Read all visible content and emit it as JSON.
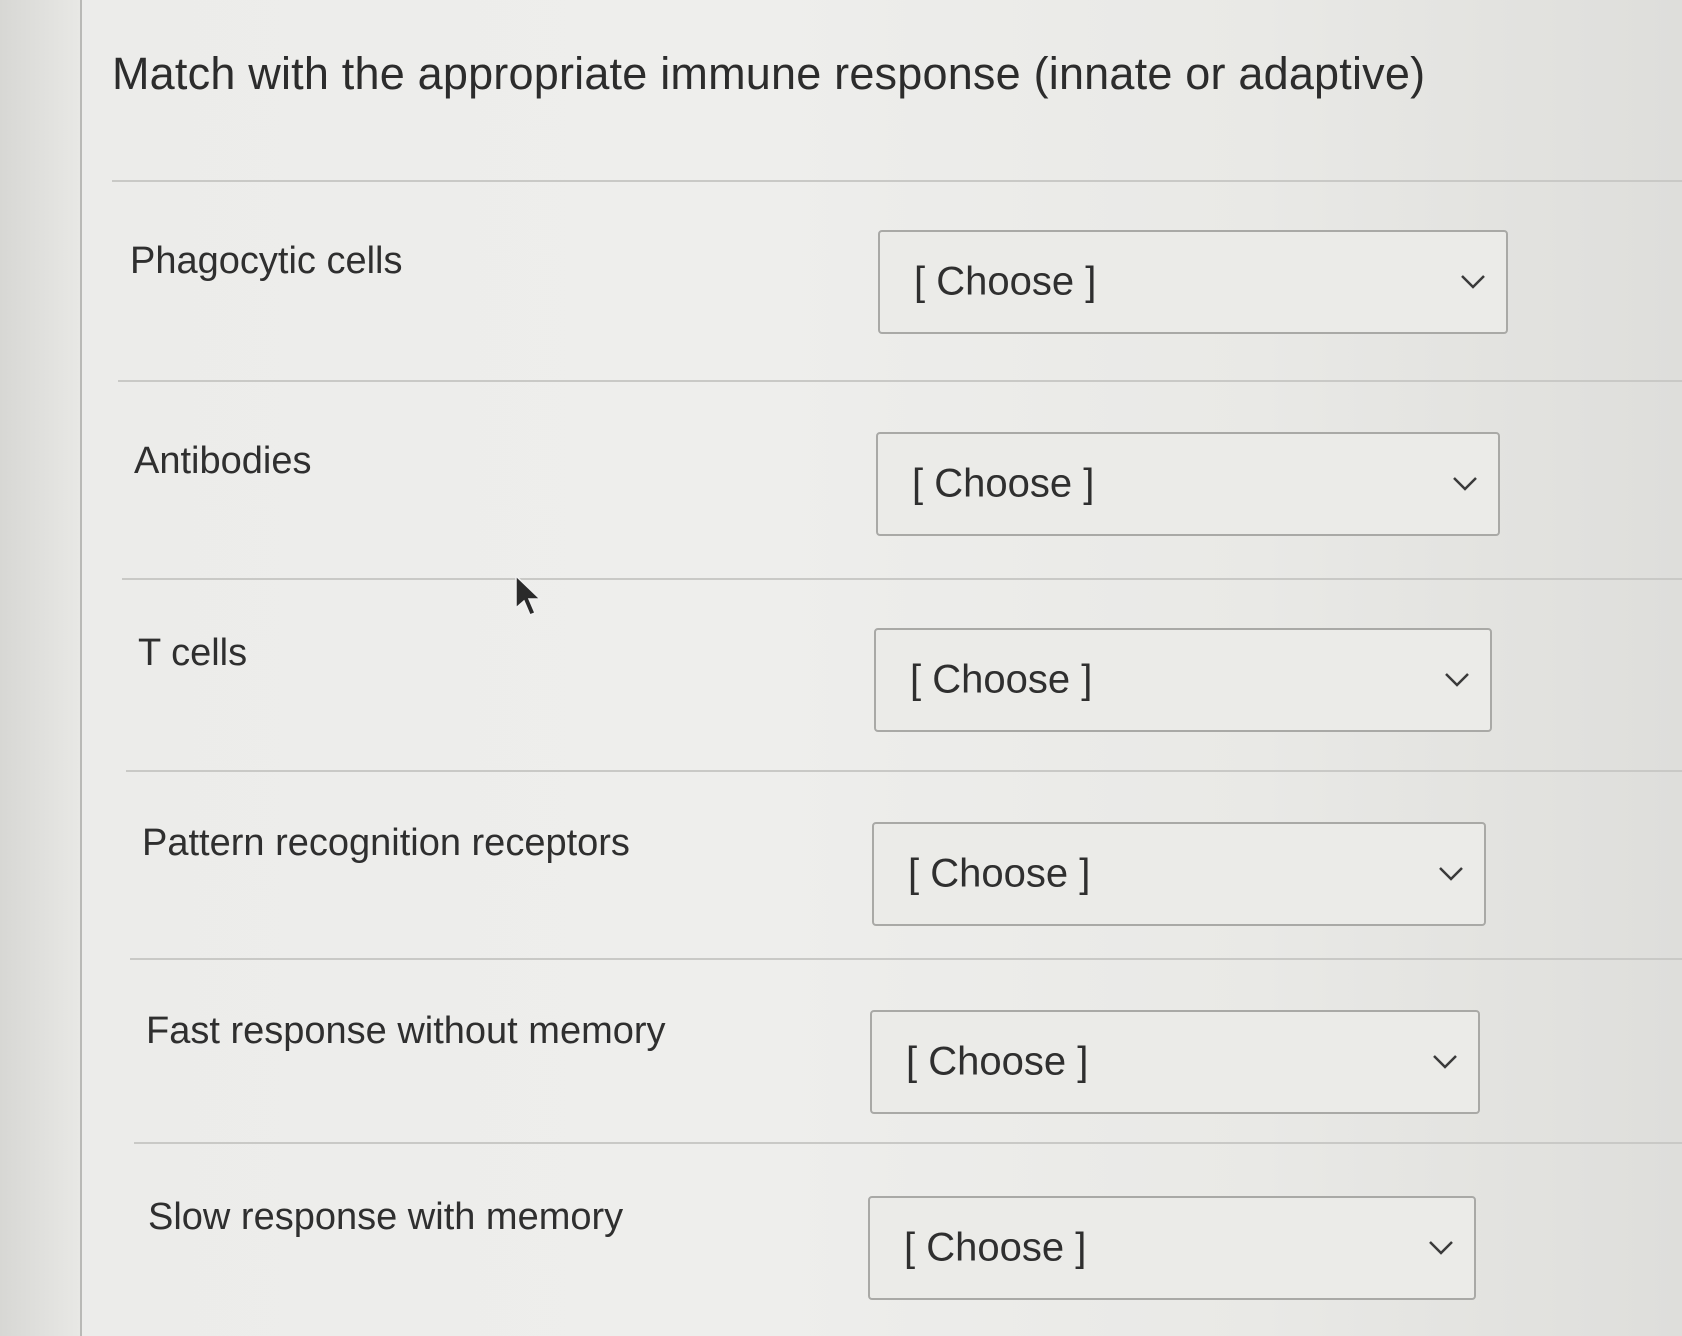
{
  "question": {
    "title": "Match with the appropriate immune response (innate or adaptive)"
  },
  "rows": [
    {
      "label": "Phagocytic cells",
      "select_value": "[ Choose ]"
    },
    {
      "label": "Antibodies",
      "select_value": "[ Choose ]"
    },
    {
      "label": "T cells",
      "select_value": "[ Choose ]"
    },
    {
      "label": "Pattern recognition receptors",
      "select_value": "[ Choose ]"
    },
    {
      "label": "Fast response without memory",
      "select_value": "[ Choose ]"
    },
    {
      "label": "Slow response with memory",
      "select_value": "[ Choose ]"
    }
  ],
  "icons": {
    "dropdown": "chevron-down-icon",
    "pointer": "mouse-cursor-icon"
  },
  "colors": {
    "text": "#2f2f2f",
    "border": "#a9a9a6",
    "background": "#ececea"
  }
}
